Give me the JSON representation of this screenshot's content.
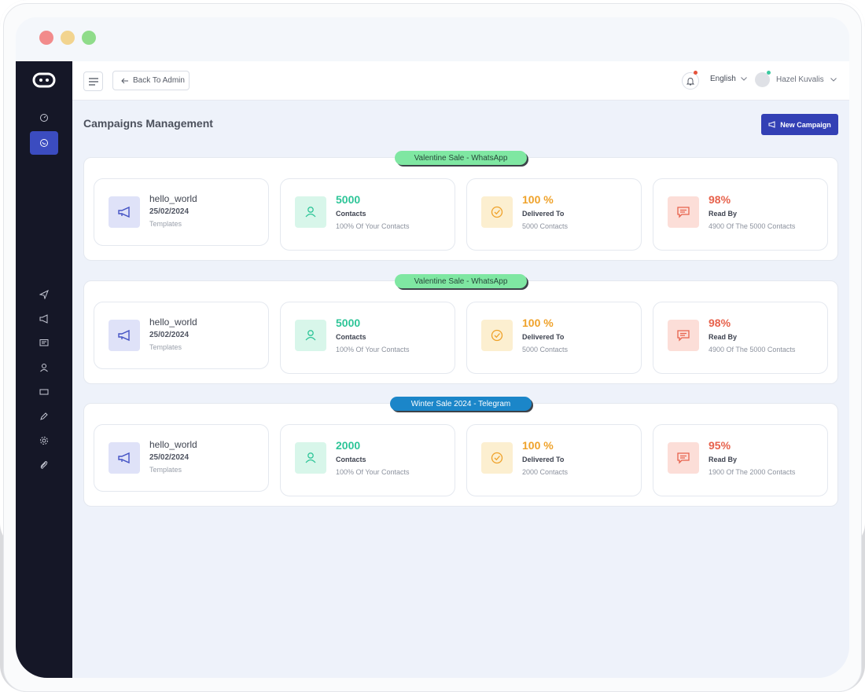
{
  "topbar": {
    "back_label": "Back To Admin",
    "language": "English",
    "user_name": "Hazel Kuvalis"
  },
  "page": {
    "title": "Campaigns Management",
    "new_campaign_label": "New Campaign"
  },
  "sidebar": {
    "top_items": [
      "dashboard-icon",
      "whatsapp-icon"
    ],
    "items": [
      "send-icon",
      "megaphone-icon",
      "message-icon",
      "user-icon",
      "ticket-icon",
      "pen-icon",
      "settings-icon",
      "attachment-icon"
    ]
  },
  "campaigns": [
    {
      "tag": "Valentine Sale - WhatsApp",
      "tag_color": "#7fe7a2",
      "template": {
        "name": "hello_world",
        "date": "25/02/2024",
        "label": "Templates"
      },
      "contacts": {
        "value": "5000",
        "label": "Contacts",
        "sub": "100% Of Your Contacts"
      },
      "delivered": {
        "value": "100 %",
        "label": "Delivered To",
        "sub": "5000 Contacts"
      },
      "read": {
        "value": "98%",
        "label": "Read By",
        "sub": "4900 Of The 5000 Contacts"
      }
    },
    {
      "tag": "Valentine Sale - WhatsApp",
      "tag_color": "#7fe7a2",
      "template": {
        "name": "hello_world",
        "date": "25/02/2024",
        "label": "Templates"
      },
      "contacts": {
        "value": "5000",
        "label": "Contacts",
        "sub": "100% Of Your Contacts"
      },
      "delivered": {
        "value": "100 %",
        "label": "Delivered To",
        "sub": "5000 Contacts"
      },
      "read": {
        "value": "98%",
        "label": "Read By",
        "sub": "4900 Of The 5000 Contacts"
      }
    },
    {
      "tag": "Winter Sale 2024 - Telegram",
      "tag_color": "#1b86c9",
      "template": {
        "name": "hello_world",
        "date": "25/02/2024",
        "label": "Templates"
      },
      "contacts": {
        "value": "2000",
        "label": "Contacts",
        "sub": "100% Of Your Contacts"
      },
      "delivered": {
        "value": "100 %",
        "label": "Delivered To",
        "sub": "2000 Contacts"
      },
      "read": {
        "value": "95%",
        "label": "Read By",
        "sub": "1900 Of The 2000 Contacts"
      }
    }
  ],
  "colors": {
    "sidebar": "#151727",
    "accent": "#3340b5",
    "contacts": "#2ec598",
    "delivered": "#efa22a",
    "read": "#e7624c"
  }
}
